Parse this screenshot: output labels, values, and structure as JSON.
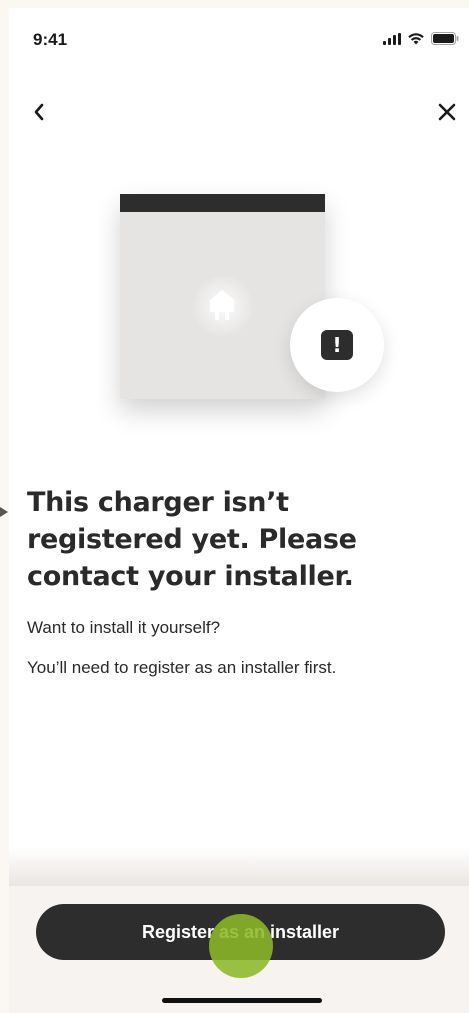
{
  "status_bar": {
    "time": "9:41",
    "icons": [
      "signal-icon",
      "wifi-icon",
      "battery-icon"
    ]
  },
  "nav": {
    "back_icon": "chevron-left-icon",
    "close_icon": "close-icon"
  },
  "illustration": {
    "device_icon": "plug-icon",
    "alert_icon": "exclamation-icon",
    "alert_glyph": "!"
  },
  "content": {
    "heading": "This charger isn’t registered yet. Please contact your installer.",
    "body_line_1": "Want to install it yourself?",
    "body_line_2": "You’ll need to register as an installer first."
  },
  "actions": {
    "primary_label": "Register as an installer"
  },
  "colors": {
    "primary": "#2d2d2d",
    "text": "#2a2a2a",
    "tap_indicator": "#8db828",
    "background": "#ffffff"
  }
}
